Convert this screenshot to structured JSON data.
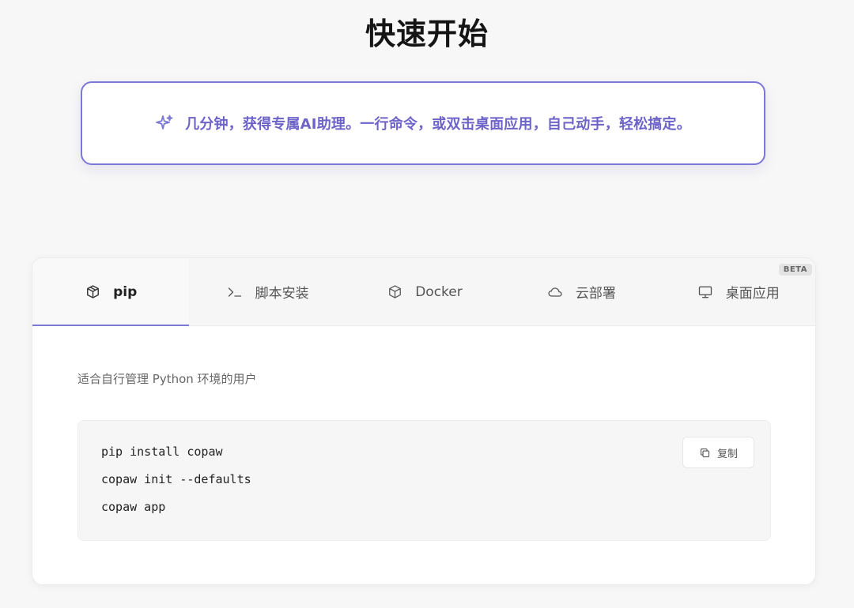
{
  "page": {
    "title": "快速开始"
  },
  "banner": {
    "icon": "sparkle-icon",
    "text": "几分钟，获得专属AI助理。一行命令，或双击桌面应用，自己动手，轻松搞定。",
    "accent_color": "#7b78d6",
    "text_color": "#6e63c8"
  },
  "tabs": [
    {
      "label": "pip",
      "icon": "package-icon",
      "active": true
    },
    {
      "label": "脚本安装",
      "icon": "terminal-icon",
      "active": false
    },
    {
      "label": "Docker",
      "icon": "box-icon",
      "active": false
    },
    {
      "label": "云部署",
      "icon": "cloud-icon",
      "active": false
    },
    {
      "label": "桌面应用",
      "icon": "monitor-icon",
      "active": false,
      "badge": "BETA"
    }
  ],
  "panel": {
    "description": "适合自行管理 Python 环境的用户",
    "code_lines": [
      "pip install copaw",
      "copaw init --defaults",
      "copaw app"
    ],
    "copy_label": "复制",
    "copy_icon": "copy-icon"
  }
}
